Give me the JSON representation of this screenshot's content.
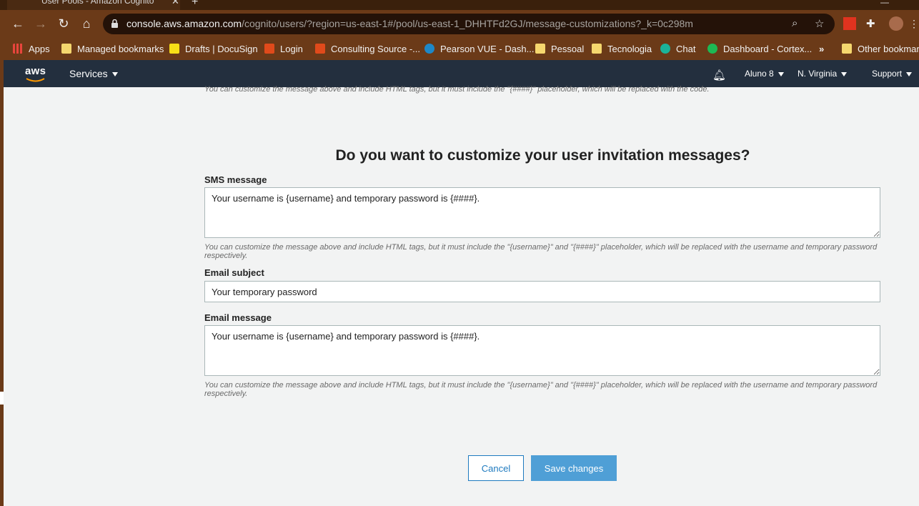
{
  "browser": {
    "tab_title": "User Pools - Amazon Cognito",
    "tab_close": "✕",
    "new_tab": "+",
    "url_host": "console.aws.amazon.com",
    "url_path": "/cognito/users/?region=us-east-1#/pool/us-east-1_DHHTFd2GJ/message-customizations?_k=0c298m",
    "bookmarks": [
      {
        "label": "Apps",
        "icon": "apps-grid-icon",
        "color": "#e8453c"
      },
      {
        "label": "Managed bookmarks",
        "icon": "folder-icon",
        "color": "#f5d76e"
      },
      {
        "label": "Drafts | DocuSign",
        "icon": "docusign-icon",
        "color": "#f7e017"
      },
      {
        "label": "Login",
        "icon": "bookmark-site-icon",
        "color": "#e04a1b"
      },
      {
        "label": "Consulting Source -...",
        "icon": "bookmark-site-icon",
        "color": "#e04a1b"
      },
      {
        "label": "Pearson VUE - Dash...",
        "icon": "pearson-icon",
        "color": "#1e88c8"
      },
      {
        "label": "Pessoal",
        "icon": "folder-icon",
        "color": "#f5d76e"
      },
      {
        "label": "Tecnologia",
        "icon": "folder-icon",
        "color": "#f5d76e"
      },
      {
        "label": "Chat",
        "icon": "chat-icon",
        "color": "#1bb39a"
      },
      {
        "label": "Dashboard - Cortex...",
        "icon": "cortex-icon",
        "color": "#1db954"
      },
      {
        "label": "»",
        "icon": "",
        "color": ""
      },
      {
        "label": "Other bookmarks",
        "icon": "folder-icon",
        "color": "#f5d76e"
      }
    ]
  },
  "aws_nav": {
    "logo": "aws",
    "services": "Services",
    "account": "Aluno 8",
    "region": "N. Virginia",
    "support": "Support"
  },
  "page": {
    "top_help": "You can customize the message above and include HTML tags, but it must include the \"{####}\" placeholder, which will be replaced with the code.",
    "heading": "Do you want to customize your user invitation messages?",
    "sms_label": "SMS message",
    "sms_value": "Your username is {username} and temporary password is {####}.",
    "sms_help": "You can customize the message above and include HTML tags, but it must include the \"{username}\" and \"{####}\" placeholder, which will be replaced with the username and temporary password respectively.",
    "subject_label": "Email subject",
    "subject_value": "Your temporary password",
    "email_label": "Email message",
    "email_value": "Your username is {username} and temporary password is {####}.",
    "email_help": "You can customize the message above and include HTML tags, but it must include the \"{username}\" and \"{####}\" placeholder, which will be replaced with the username and temporary password respectively.",
    "cancel": "Cancel",
    "save": "Save changes"
  }
}
